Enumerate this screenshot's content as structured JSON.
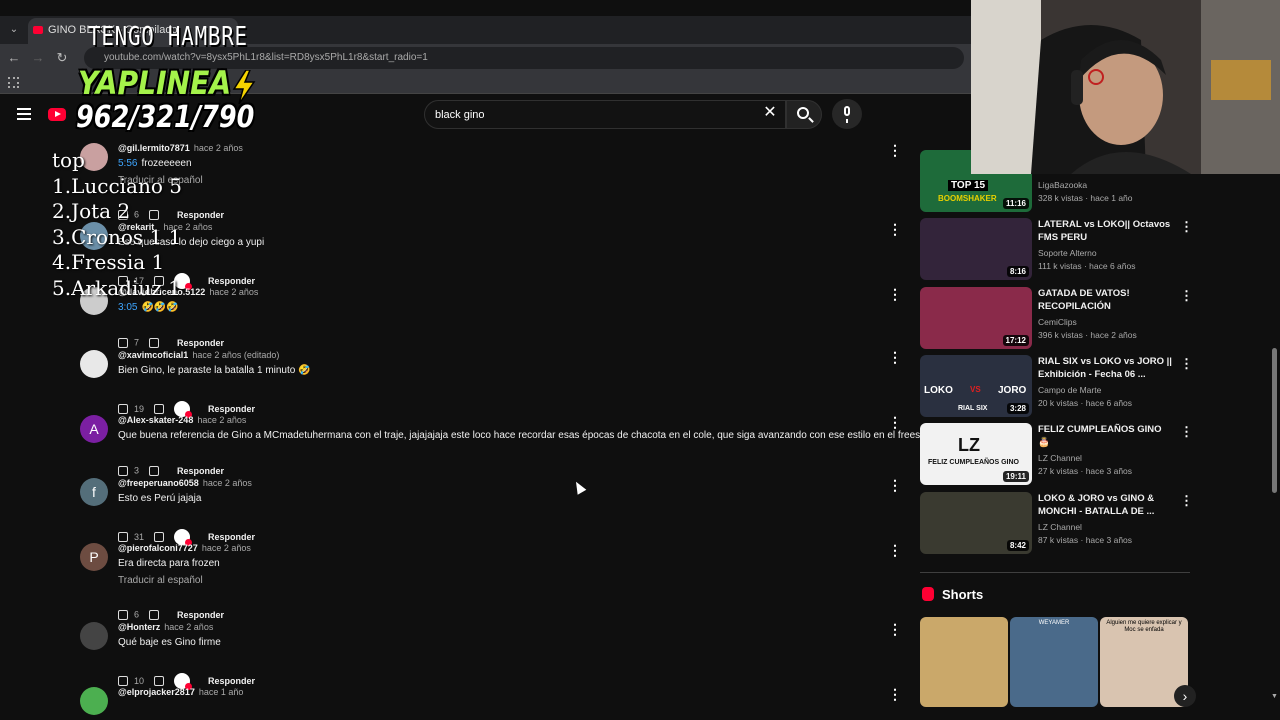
{
  "browser": {
    "tab_title": "GINO BLACK - Compilado",
    "url": "youtube.com/watch?v=8ysx5PhL1r8&list=RD8ysx5PhL1r8&start_radio=1"
  },
  "search": {
    "query": "black gino"
  },
  "comments": [
    {
      "user": "@gil.lermito7871",
      "time": "hace 2 años",
      "timestamp": "5:56",
      "text": "frozeeeeen",
      "translate": "Traducir al español",
      "likes": "6",
      "heart": false,
      "reply": "Responder"
    },
    {
      "user": "@rekarit_",
      "time": "hace 2 años",
      "timestamp": "",
      "text": "Ese quesaso lo dejo ciego a yupi",
      "translate": "",
      "likes": "17",
      "heart": true,
      "reply": "Responder"
    },
    {
      "user": "@davidbriceno.5122",
      "time": "hace 2 años",
      "timestamp": "3:05",
      "text": "🤣🤣🤣",
      "translate": "",
      "likes": "7",
      "heart": false,
      "reply": "Responder"
    },
    {
      "user": "@xavimcoficial1",
      "time": "hace 2 años (editado)",
      "timestamp": "",
      "text": "Bien Gino, le paraste la batalla 1 minuto 🤣",
      "translate": "",
      "likes": "19",
      "heart": true,
      "reply": "Responder"
    },
    {
      "user": "@Alex-skater-248",
      "time": "hace 2 años",
      "timestamp": "",
      "text": "Que buena referencia de Gino a MCmadetuhermana con el traje, jajajajaja este loco hace recordar esas épocas de chacota en el cole, que siga avanzando con ese estilo en el freestyle 👍",
      "translate": "",
      "likes": "3",
      "heart": false,
      "reply": "Responder"
    },
    {
      "user": "@freeperuano6058",
      "time": "hace 2 años",
      "timestamp": "",
      "text": "Esto es Perú jajaja",
      "translate": "",
      "likes": "31",
      "heart": true,
      "reply": "Responder"
    },
    {
      "user": "@pierofalconi7727",
      "time": "hace 2 años",
      "timestamp": "",
      "text": "Era directa para frozen",
      "translate": "Traducir al español",
      "likes": "6",
      "heart": false,
      "reply": "Responder"
    },
    {
      "user": "@Honterz",
      "time": "hace 2 años",
      "timestamp": "",
      "text": "Qué baje es Gino firme",
      "translate": "",
      "likes": "10",
      "heart": true,
      "reply": "Responder"
    },
    {
      "user": "@elprojacker2817",
      "time": "hace 1 año",
      "timestamp": "",
      "text": "",
      "translate": "",
      "likes": "",
      "heart": false,
      "reply": ""
    }
  ],
  "avatars": [
    {
      "letter": "",
      "color": "#c9a0a0"
    },
    {
      "letter": "",
      "color": "#6b8fa8"
    },
    {
      "letter": "",
      "color": "#cccccc"
    },
    {
      "letter": "",
      "color": "#e8e8e8"
    },
    {
      "letter": "A",
      "color": "#7b1fa2"
    },
    {
      "letter": "f",
      "color": "#546e7a"
    },
    {
      "letter": "P",
      "color": "#6d4c41"
    },
    {
      "letter": "",
      "color": "#444444"
    },
    {
      "letter": "",
      "color": "#4caf50"
    }
  ],
  "videos": [
    {
      "title": "",
      "channel": "LigaBazooka",
      "views": "328 k vistas · hace 1 año",
      "duration": "11:16",
      "thumb_color": "#1e6b3a"
    },
    {
      "title": "LATERAL vs LOKO|| Octavos FMS PERU",
      "channel": "Soporte Alterno",
      "views": "111 k vistas · hace 6 años",
      "duration": "8:16",
      "thumb_color": "#33243a"
    },
    {
      "title": "GATADA DE VATOS! RECOPILACIÓN #NelsonCapit...",
      "channel": "CemiClips",
      "views": "396 k vistas · hace 2 años",
      "duration": "17:12",
      "thumb_color": "#8a2a4a"
    },
    {
      "title": "RIAL SIX vs LOKO vs JORO || Exhibición - Fecha 06 ...",
      "channel": "Campo de Marte",
      "views": "20 k vistas · hace 6 años",
      "duration": "3:28",
      "thumb_color": "#2a3040"
    },
    {
      "title": "FELIZ CUMPLEAÑOS GINO 🎂",
      "channel": "LZ Channel",
      "views": "27 k vistas · hace 3 años",
      "duration": "19:11",
      "thumb_color": "#f2f2f2"
    },
    {
      "title": "LOKO & JORO vs GINO & MONCHI - BATALLA DE ...",
      "channel": "LZ Channel",
      "views": "87 k vistas · hace 3 años",
      "duration": "8:42",
      "thumb_color": "#3a3a30"
    }
  ],
  "thumb_texts": {
    "top15": "TOP 15",
    "boomshaker": "BOOMSHAKER",
    "loko": "LOKO",
    "vs": "VS",
    "joro": "JORO",
    "rialsix": "RIAL SIX",
    "lz": "LZ",
    "feliz": "FELIZ CUMPLEAÑOS GINO"
  },
  "shorts": {
    "title": "Shorts",
    "items": [
      {
        "color": "#caa86a",
        "caption": ""
      },
      {
        "color": "#4a6a8a",
        "caption": "WEYAMER"
      },
      {
        "color": "#d9c4b0",
        "caption": "Alguien me quiere explicar y Moc se enfada"
      }
    ]
  },
  "overlay": {
    "hambre": "TENGO HAMBRE",
    "yape": "YAPLINEA",
    "phone": "962/321/790",
    "ranking": [
      "top",
      "1.Lucciano 5",
      "2.Jota 2",
      "3.Cronos 1 1",
      "4.Fressia 1",
      "5.Arkadiuz 1"
    ]
  }
}
